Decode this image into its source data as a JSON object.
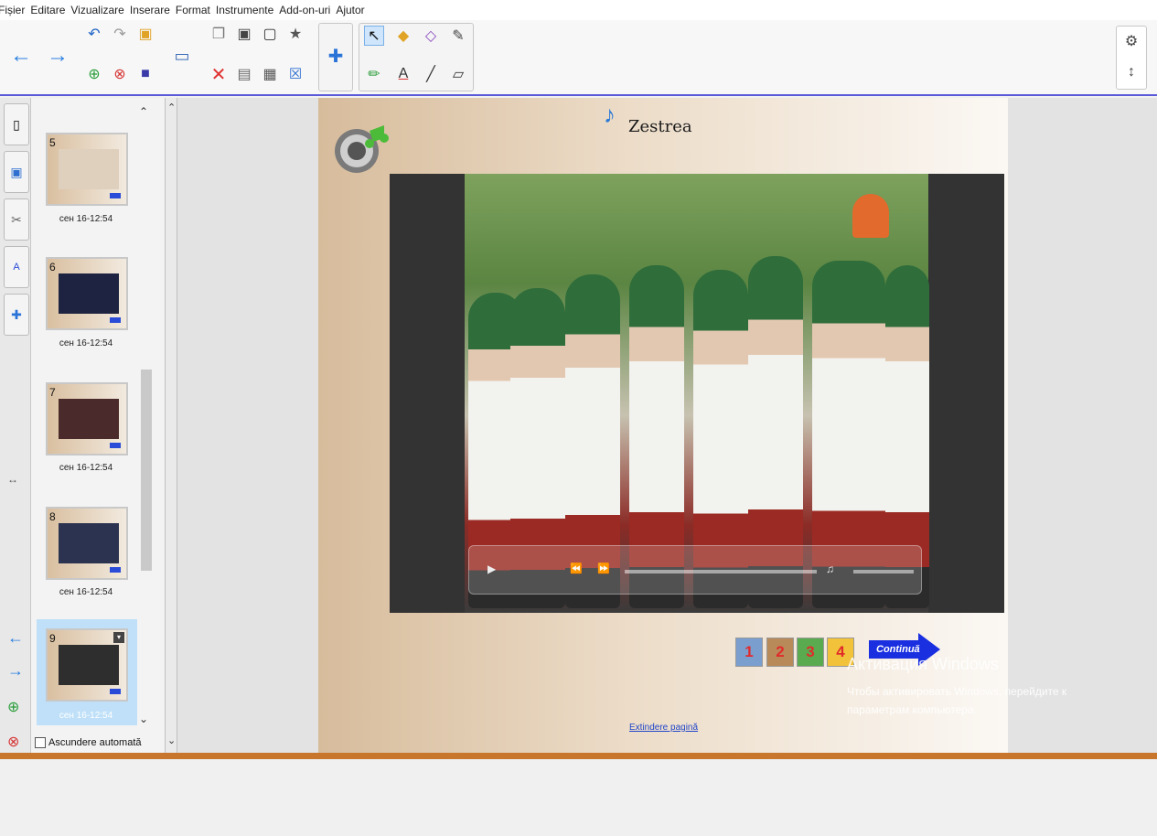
{
  "menu": [
    "Fișier",
    "Editare",
    "Vizualizare",
    "Inserare",
    "Format",
    "Instrumente",
    "Add-on-uri",
    "Ajutor"
  ],
  "colors": {
    "accent": "#2a4bd8",
    "selection": "#cfe5fb",
    "page_left": "#d7bc9c",
    "page_right": "#fbf8f4",
    "red_number": "#e12b2b"
  },
  "toolbar": {
    "icons": [
      "back-arrow-icon",
      "forward-arrow-icon",
      "undo-icon",
      "redo-icon",
      "open-folder-icon",
      "add-page-icon",
      "delete-page-icon",
      "save-icon",
      "screen-icon",
      "copy-icon",
      "capture-icon",
      "insert-image-icon",
      "magic-icon",
      "delete-icon",
      "screen-shade-icon",
      "table-icon",
      "clear-icon",
      "add-on-puzzle-icon",
      "select-icon",
      "fill-icon",
      "eraser-icon",
      "magic-pen-icon",
      "pens-icon",
      "text-icon",
      "line-icon",
      "shape-icon",
      "settings-gear-icon",
      "vertical-move-icon"
    ]
  },
  "sidebar": {
    "thumbnails": [
      {
        "num": "5",
        "caption": "сен 16-12:54"
      },
      {
        "num": "6",
        "caption": "сен 16-12:54"
      },
      {
        "num": "7",
        "caption": "сен 16-12:54"
      },
      {
        "num": "8",
        "caption": "сен 16-12:54"
      },
      {
        "num": "9",
        "caption": "сен 16-12:54"
      }
    ],
    "autohide_label": "Ascundere automată"
  },
  "page": {
    "title": "Zestrea",
    "nav_numbers": [
      "1",
      "2",
      "3",
      "4"
    ],
    "continue_label": "Continuă",
    "extend_link": "Extindere pagină"
  },
  "watermark": {
    "line1": "Активация Windows",
    "line2": "Чтобы активировать Windows, перейдите к",
    "line3": "параметрам компьютера."
  }
}
